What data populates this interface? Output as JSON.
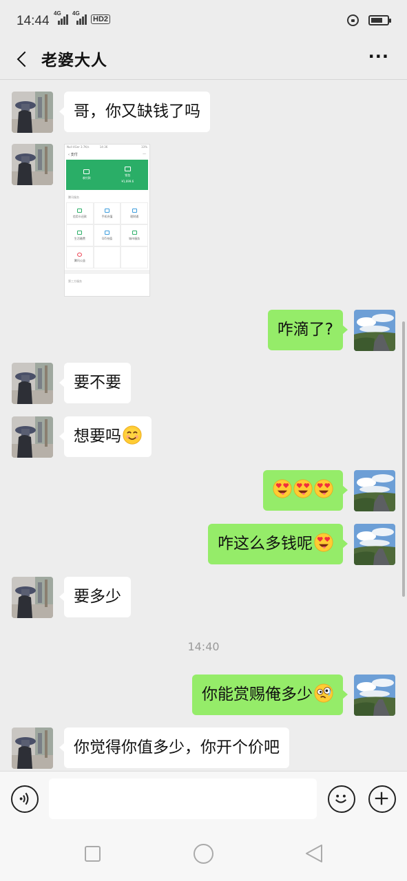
{
  "status_bar": {
    "time": "14:44",
    "network_1": "4G",
    "network_2": "4G",
    "hd_badge": "HD2",
    "icons": [
      "signal-icon",
      "signal-icon",
      "hd-icon",
      "lock-rotation-icon",
      "battery-icon"
    ]
  },
  "header": {
    "title": "老婆大人",
    "more_label": "···"
  },
  "messages": [
    {
      "side": "in",
      "text": "哥，你又缺钱了吗"
    },
    {
      "side": "in",
      "type": "image",
      "image": {
        "status_left": "Null 4Ger 3.7K/s",
        "status_time": "14:36",
        "status_right": "33%",
        "nav_title": "支付",
        "green_left": "收付款",
        "green_right": "钱包",
        "green_right_sub": "¥1,699.6",
        "section1": "腾讯服务",
        "grid": [
          "信用卡还款",
          "手机充值",
          "理财通",
          "生活缴费",
          "Q币充值",
          "城市服务",
          "腾讯公益"
        ],
        "section2": "第三方服务"
      }
    },
    {
      "side": "out",
      "text": "咋滴了?"
    },
    {
      "side": "in",
      "text": "要不要"
    },
    {
      "side": "in",
      "text": "想要吗",
      "emoji": [
        "smile-emoji"
      ]
    },
    {
      "side": "out",
      "text": "",
      "emoji": [
        "heart-eyes-emoji",
        "heart-eyes-emoji",
        "heart-eyes-emoji"
      ]
    },
    {
      "side": "out",
      "text": "咋这么多钱呢",
      "emoji": [
        "heart-eyes-emoji"
      ]
    },
    {
      "side": "in",
      "text": "要多少"
    },
    {
      "side": "time",
      "text": "14:40"
    },
    {
      "side": "out",
      "text": "你能赏赐俺多少",
      "emoji": [
        "dizzy-face-emoji"
      ]
    },
    {
      "side": "in",
      "text": "你觉得你值多少，你开个价吧"
    }
  ],
  "input_bar": {
    "value": "",
    "icons": [
      "voice-icon",
      "emoji-icon",
      "plus-icon"
    ]
  },
  "system_nav": [
    "recent-apps-icon",
    "home-icon",
    "back-icon"
  ]
}
